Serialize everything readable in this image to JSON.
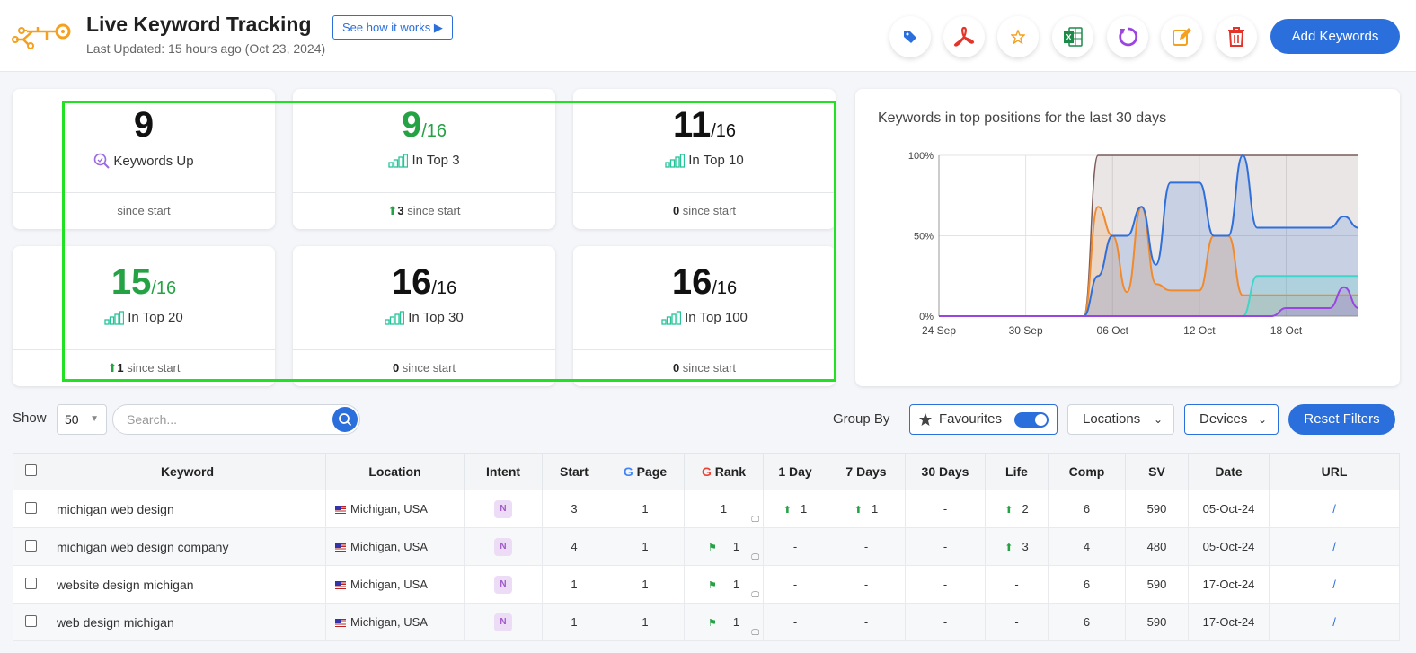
{
  "header": {
    "title": "Live Keyword Tracking",
    "how_it_works": "See how it works ▶",
    "last_updated": "Last Updated: 15 hours ago (Oct 23, 2024)",
    "add_keywords": "Add Keywords"
  },
  "toolbar_icons": [
    "tag-icon",
    "pdf-icon",
    "star-icon",
    "excel-icon",
    "refresh-icon",
    "edit-icon",
    "trash-icon"
  ],
  "stats": [
    {
      "value": "9",
      "total": "",
      "label": "Keywords Up",
      "since_value": "",
      "since_label": "since start",
      "arrow": false
    },
    {
      "value": "9",
      "total": "/16",
      "label": "In Top 3",
      "since_value": "3",
      "since_label": "since start",
      "arrow": true
    },
    {
      "value": "11",
      "total": "/16",
      "label": "In Top 10",
      "since_value": "0",
      "since_label": "since start",
      "arrow": false
    },
    {
      "value": "15",
      "total": "/16",
      "label": "In Top 20",
      "since_value": "1",
      "since_label": "since start",
      "arrow": true
    },
    {
      "value": "16",
      "total": "/16",
      "label": "In Top 30",
      "since_value": "0",
      "since_label": "since start",
      "arrow": false
    },
    {
      "value": "16",
      "total": "/16",
      "label": "In Top 100",
      "since_value": "0",
      "since_label": "since start",
      "arrow": false
    }
  ],
  "chart": {
    "title": "Keywords in top positions for the last 30 days",
    "y_ticks": [
      "100%",
      "50%",
      "0%"
    ],
    "x_ticks": [
      "24 Sep",
      "30 Sep",
      "06 Oct",
      "12 Oct",
      "18 Oct"
    ]
  },
  "chart_data": {
    "type": "area",
    "title": "Keywords in top positions for the last 30 days",
    "ylim": [
      0,
      100
    ],
    "x": [
      "24 Sep",
      "30 Sep",
      "04 Oct",
      "05 Oct",
      "06 Oct",
      "07 Oct",
      "08 Oct",
      "09 Oct",
      "10 Oct",
      "11 Oct",
      "12 Oct",
      "13 Oct",
      "14 Oct",
      "15 Oct",
      "16 Oct",
      "17 Oct",
      "18 Oct",
      "19 Oct",
      "20 Oct",
      "21 Oct",
      "22 Oct",
      "23 Oct"
    ],
    "series": [
      {
        "color": "#7b5a5a",
        "values": [
          0,
          0,
          0,
          100,
          100,
          100,
          100,
          100,
          100,
          100,
          100,
          100,
          100,
          100,
          100,
          100,
          100,
          100,
          100,
          100,
          100,
          100
        ]
      },
      {
        "color": "#f08a2c",
        "values": [
          0,
          0,
          0,
          68,
          50,
          15,
          68,
          20,
          16,
          16,
          16,
          50,
          50,
          13,
          13,
          13,
          13,
          13,
          13,
          13,
          13,
          13
        ]
      },
      {
        "color": "#2f6fd9",
        "values": [
          0,
          0,
          0,
          25,
          50,
          50,
          68,
          32,
          83,
          83,
          83,
          50,
          50,
          100,
          55,
          55,
          55,
          55,
          55,
          55,
          62,
          55
        ]
      },
      {
        "color": "#3dd6c9",
        "values": [
          0,
          0,
          0,
          0,
          0,
          0,
          0,
          0,
          0,
          0,
          0,
          0,
          0,
          0,
          25,
          25,
          25,
          25,
          25,
          25,
          25,
          25
        ]
      },
      {
        "color": "#9a45e0",
        "values": [
          0,
          0,
          0,
          0,
          0,
          0,
          0,
          0,
          0,
          0,
          0,
          0,
          0,
          0,
          0,
          0,
          5,
          5,
          5,
          5,
          18,
          5
        ]
      }
    ]
  },
  "controls": {
    "show_label": "Show",
    "show_value": "50",
    "search_placeholder": "Search...",
    "group_by": "Group By",
    "favourites": "Favourites",
    "locations": "Locations",
    "devices": "Devices",
    "reset_filters": "Reset Filters"
  },
  "table": {
    "columns": [
      "Keyword",
      "Location",
      "Intent",
      "Start",
      "Page",
      "Rank",
      "1 Day",
      "7 Days",
      "30 Days",
      "Life",
      "Comp",
      "SV",
      "Date",
      "URL"
    ],
    "rows": [
      {
        "keyword": "michigan web design",
        "location": "Michigan, USA",
        "intent": "N",
        "start": "3",
        "page": "1",
        "rank": "1",
        "rank_flag": false,
        "day1": "1",
        "day1_up": true,
        "day7": "1",
        "day7_up": true,
        "day30": "-",
        "life": "2",
        "life_up": true,
        "comp": "6",
        "sv": "590",
        "date": "05-Oct-24",
        "url": "/"
      },
      {
        "keyword": "michigan web design company",
        "location": "Michigan, USA",
        "intent": "N",
        "start": "4",
        "page": "1",
        "rank": "1",
        "rank_flag": true,
        "day1": "-",
        "day1_up": false,
        "day7": "-",
        "day7_up": false,
        "day30": "-",
        "life": "3",
        "life_up": true,
        "comp": "4",
        "sv": "480",
        "date": "05-Oct-24",
        "url": "/"
      },
      {
        "keyword": "website design michigan",
        "location": "Michigan, USA",
        "intent": "N",
        "start": "1",
        "page": "1",
        "rank": "1",
        "rank_flag": true,
        "day1": "-",
        "day1_up": false,
        "day7": "-",
        "day7_up": false,
        "day30": "-",
        "life": "-",
        "life_up": false,
        "comp": "6",
        "sv": "590",
        "date": "17-Oct-24",
        "url": "/"
      },
      {
        "keyword": "web design michigan",
        "location": "Michigan, USA",
        "intent": "N",
        "start": "1",
        "page": "1",
        "rank": "1",
        "rank_flag": true,
        "day1": "-",
        "day1_up": false,
        "day7": "-",
        "day7_up": false,
        "day30": "-",
        "life": "-",
        "life_up": false,
        "comp": "6",
        "sv": "590",
        "date": "17-Oct-24",
        "url": "/"
      }
    ]
  }
}
